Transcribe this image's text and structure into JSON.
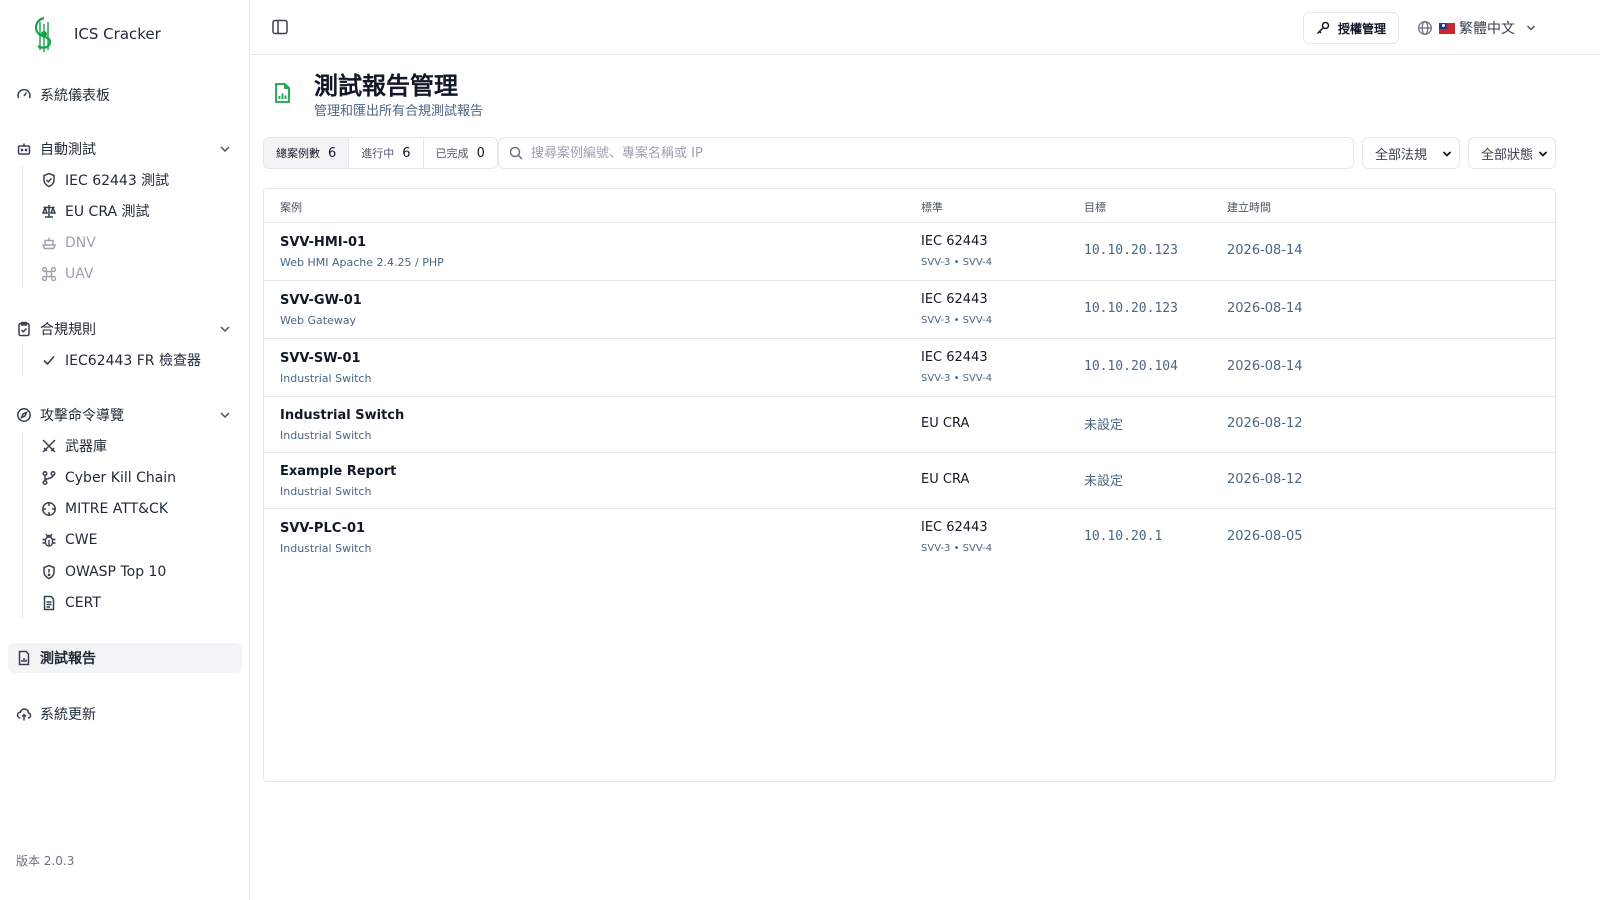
{
  "app": {
    "name": "ICS Cracker",
    "version": "版本 2.0.3"
  },
  "sidebar": {
    "dashboard": "系統儀表板",
    "auto_test": {
      "label": "自動測試",
      "items": [
        {
          "label": "IEC 62443 測試",
          "icon": "shield-check-icon",
          "disabled": false
        },
        {
          "label": "EU CRA 測試",
          "icon": "scale-icon",
          "disabled": false
        },
        {
          "label": "DNV",
          "icon": "ship-icon",
          "disabled": true
        },
        {
          "label": "UAV",
          "icon": "drone-icon",
          "disabled": true
        }
      ]
    },
    "compliance": {
      "label": "合規規則",
      "items": [
        {
          "label": "IEC62443 FR 檢查器",
          "icon": "check-icon"
        }
      ]
    },
    "attack": {
      "label": "攻擊命令導覽",
      "items": [
        {
          "label": "武器庫",
          "icon": "swords-icon"
        },
        {
          "label": "Cyber Kill Chain",
          "icon": "git-branch-icon"
        },
        {
          "label": "MITRE ATT&CK",
          "icon": "crosshair-icon"
        },
        {
          "label": "CWE",
          "icon": "bug-icon"
        },
        {
          "label": "OWASP Top 10",
          "icon": "shield-alert-icon"
        },
        {
          "label": "CERT",
          "icon": "file-text-icon"
        }
      ]
    },
    "reports": "測試報告",
    "update": "系統更新"
  },
  "topbar": {
    "license_label": "授權管理",
    "language_label": "繁體中文"
  },
  "header": {
    "title": "測試報告管理",
    "subtitle": "管理和匯出所有合規測試報告"
  },
  "filters": {
    "counts": [
      {
        "label": "總案例數",
        "value": "6"
      },
      {
        "label": "進行中",
        "value": "6"
      },
      {
        "label": "已完成",
        "value": "0"
      }
    ],
    "search_placeholder": "搜尋案例編號、專案名稱或 IP",
    "standard_select": "全部法規",
    "status_select": "全部狀態"
  },
  "table": {
    "columns": [
      "案例",
      "標準",
      "目標",
      "建立時間"
    ],
    "rows": [
      {
        "name": "SVV-HMI-01",
        "desc": "Web HMI Apache 2.4.25 / PHP",
        "standard": "IEC 62443",
        "levels": "SVV-3 • SVV-4",
        "target": "10.10.20.123",
        "date": "2026-08-14"
      },
      {
        "name": "SVV-GW-01",
        "desc": "Web Gateway",
        "standard": "IEC 62443",
        "levels": "SVV-3 • SVV-4",
        "target": "10.10.20.123",
        "date": "2026-08-14"
      },
      {
        "name": "SVV-SW-01",
        "desc": "Industrial Switch",
        "standard": "IEC 62443",
        "levels": "SVV-3 • SVV-4",
        "target": "10.10.20.104",
        "date": "2026-08-14"
      },
      {
        "name": "Industrial Switch",
        "desc": "Industrial Switch",
        "standard": "EU CRA",
        "levels": "",
        "target": "未設定",
        "date": "2026-08-12"
      },
      {
        "name": "Example Report",
        "desc": "Industrial Switch",
        "standard": "EU CRA",
        "levels": "",
        "target": "未設定",
        "date": "2026-08-12"
      },
      {
        "name": "SVV-PLC-01",
        "desc": "Industrial Switch",
        "standard": "IEC 62443",
        "levels": "SVV-3 • SVV-4",
        "target": "10.10.20.1",
        "date": "2026-08-05"
      }
    ]
  },
  "colors": {
    "brand": "#16a34a",
    "muted_text": "#4b6584",
    "border": "#e5e7eb",
    "active_bg": "#f3f4f6"
  }
}
